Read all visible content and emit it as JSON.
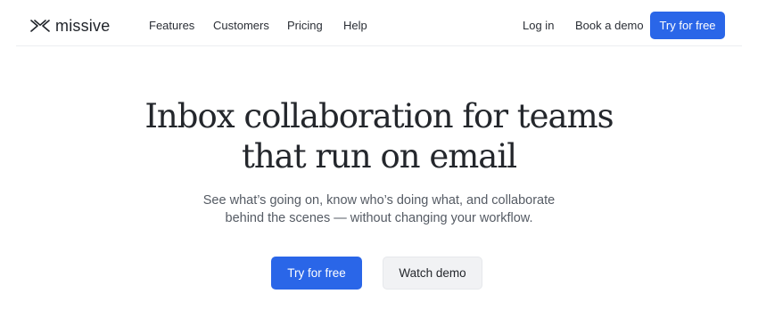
{
  "brand": {
    "name": "missive",
    "icon": "missive-logo-icon"
  },
  "nav": {
    "items": [
      {
        "label": "Features"
      },
      {
        "label": "Customers"
      },
      {
        "label": "Pricing"
      },
      {
        "label": "Help"
      }
    ],
    "login_label": "Log in",
    "demo_label": "Book a demo",
    "cta_label": "Try for free"
  },
  "hero": {
    "title_line1": "Inbox collaboration for teams",
    "title_line2": "that run on email",
    "subtitle_line1": "See what’s going on, know who’s doing what, and collaborate",
    "subtitle_line2": "behind the scenes — without changing your workflow.",
    "primary_cta": "Try for free",
    "secondary_cta": "Watch demo"
  },
  "colors": {
    "accent": "#2a66e8",
    "text": "#24272c",
    "muted_text": "#555b64",
    "secondary_button_bg": "#f1f2f4"
  }
}
